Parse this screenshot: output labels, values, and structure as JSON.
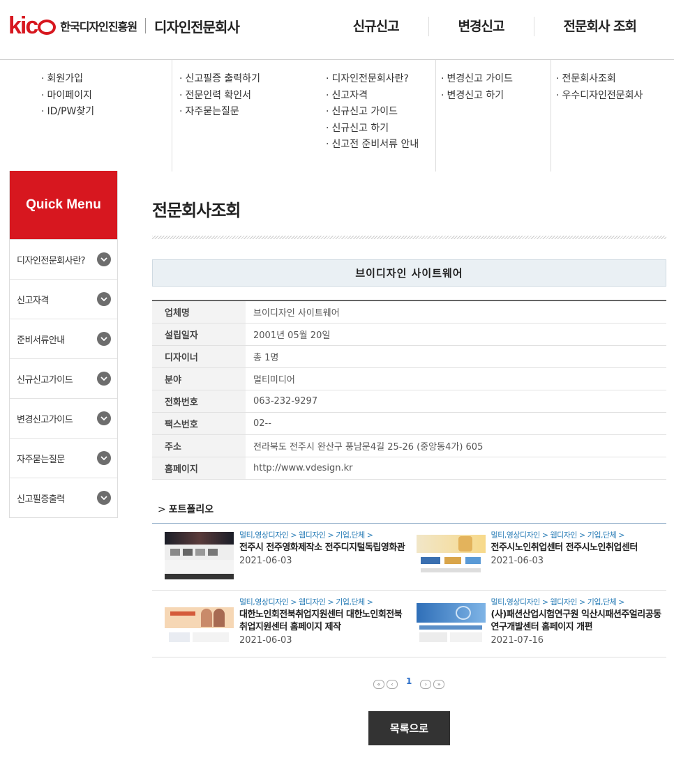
{
  "header": {
    "logo_mark": "kidp",
    "org_name": "한국디자인진흥원",
    "site_name": "디자인전문회사",
    "nav": [
      "신규신고",
      "변경신고",
      "전문회사 조회"
    ]
  },
  "mega_menu": {
    "col1": [
      "회원가입",
      "마이페이지",
      "ID/PW찾기"
    ],
    "col2": [
      "신고필증 출력하기",
      "전문인력 확인서",
      "자주묻는질문"
    ],
    "col3": [
      "디자인전문회사란?",
      "신고자격",
      "신규신고 가이드",
      "신규신고 하기",
      "신고전 준비서류 안내"
    ],
    "col4": [
      "변경신고 가이드",
      "변경신고 하기"
    ],
    "col5": [
      "전문회사조회",
      "우수디자인전문회사"
    ]
  },
  "quick_menu": {
    "title": "Quick Menu",
    "items": [
      "디자인전문회사란?",
      "신고자격",
      "준비서류안내",
      "신규신고가이드",
      "변경신고가이드",
      "자주묻는질문",
      "신고필증출력"
    ]
  },
  "page": {
    "title": "전문회사조회",
    "company_name": "브이디자인 사이트웨어"
  },
  "info": {
    "rows": [
      {
        "label": "업체명",
        "value": "브이디자인 사이트웨어"
      },
      {
        "label": "설립일자",
        "value": "2001년 05월 20일"
      },
      {
        "label": "디자이너",
        "value": "총 1명"
      },
      {
        "label": "분야",
        "value": "멀티미디어"
      },
      {
        "label": "전화번호",
        "value": "063-232-9297"
      },
      {
        "label": "팩스번호",
        "value": "02--"
      },
      {
        "label": "주소",
        "value": "전라북도 전주시 완산구 풍남문4길 25-26 (중앙동4가) 605"
      },
      {
        "label": "홈페이지",
        "value": "http://www.vdesign.kr"
      }
    ]
  },
  "portfolio": {
    "title": "포트폴리오",
    "items": [
      {
        "category": "멀티,영상디자인 > 웹디자인 > 기업,단체 >",
        "name": "전주시 전주영화제작소 전주디지털독립영화관",
        "date": "2021-06-03"
      },
      {
        "category": "멀티,영상디자인 > 웹디자인 > 기업,단체 >",
        "name": "전주시노인취업센터 전주시노인취업센터",
        "date": "2021-06-03"
      },
      {
        "category": "멀티,영상디자인 > 웹디자인 > 기업,단체 >",
        "name": "대한노인회전북취업지원센터 대한노인회전북취업지원센터 홈페이지 제작",
        "date": "2021-06-03"
      },
      {
        "category": "멀티,영상디자인 > 웹디자인 > 기업,단체 >",
        "name": "(사)패션산업시험연구원 익산시패션주얼리공동연구개발센터 홈페이지 개편",
        "date": "2021-07-16"
      }
    ]
  },
  "pagination": {
    "current": "1",
    "first": "«",
    "prev": "‹",
    "next": "›",
    "last": "»"
  },
  "buttons": {
    "back": "목록으로"
  },
  "colors": {
    "brand": "#d7171f",
    "link": "#2d7fb8",
    "dark_button": "#333333"
  }
}
